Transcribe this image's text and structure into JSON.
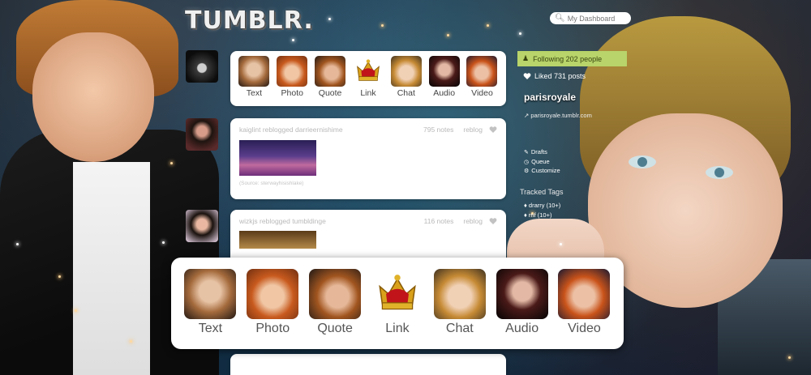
{
  "header": {
    "logo": "TUMBLR.",
    "search_placeholder": "My Dashboard"
  },
  "post_types": [
    {
      "label": "Text"
    },
    {
      "label": "Photo"
    },
    {
      "label": "Quote"
    },
    {
      "label": "Link"
    },
    {
      "label": "Chat"
    },
    {
      "label": "Audio"
    },
    {
      "label": "Video"
    }
  ],
  "posts": [
    {
      "author": "kaiglint",
      "action": "reblogged",
      "source": "darrieernishime",
      "notes": "795 notes",
      "reblog": "reblog",
      "caption": "(Source: sterwayhisishlake)"
    },
    {
      "author": "wizkjs",
      "action": "reblogged",
      "source": "tumbldinge",
      "notes": "116 notes",
      "reblog": "reblog"
    }
  ],
  "sidebar": {
    "following": "Following 202 people",
    "liked": "Liked 731 posts",
    "blog_name": "parisroyale",
    "blog_url": "parisroyale.tumblr.com",
    "links": [
      "Drafts",
      "Queue",
      "Customize"
    ],
    "tracked_title": "Tracked Tags",
    "tags": [
      "drarry (10+)",
      "rnf (10+)"
    ]
  },
  "colors": {
    "following_bg": "#b8d46a",
    "panel_bg": "#ffffff"
  }
}
